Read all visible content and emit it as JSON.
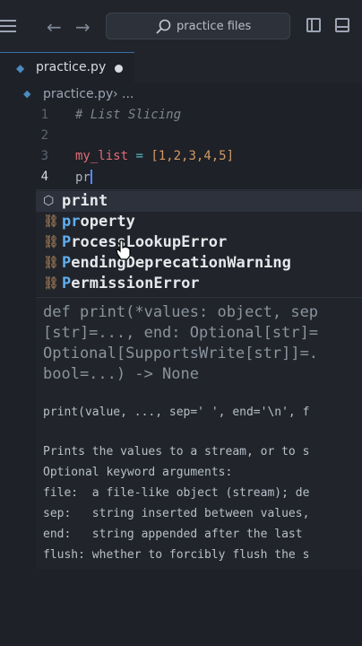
{
  "titlebar": {
    "search_text": "practice files",
    "back_arrow": "←",
    "forward_arrow": "→"
  },
  "tab": {
    "label": "practice.py",
    "modified": true
  },
  "breadcrumb": {
    "file": "practice.py",
    "separator": "› ..."
  },
  "editor": {
    "lines": [
      {
        "number": "1",
        "comment": "# List Slicing"
      },
      {
        "number": "2"
      },
      {
        "number": "3",
        "var": "my_list",
        "op": " = ",
        "open": "[",
        "values": "1,2,3,4,5",
        "close": "]"
      },
      {
        "number": "4",
        "text": "pr"
      }
    ]
  },
  "suggestions": [
    {
      "icon": "method-icon",
      "match": "print",
      "rest": "",
      "selected": true
    },
    {
      "icon": "class-icon",
      "match": "pr",
      "rest": "operty"
    },
    {
      "icon": "class-icon",
      "match": "P",
      "rest": "rocessLookupError"
    },
    {
      "icon": "class-icon",
      "match": "P",
      "rest": "endingDeprecationWarning"
    },
    {
      "icon": "class-icon",
      "match": "P",
      "rest": "ermissionError"
    }
  ],
  "docs": {
    "signature": [
      "def print(*values: object, sep",
      "[str]=..., end: Optional[str]=",
      "Optional[SupportsWrite[str]]=.",
      "bool=...) -> None"
    ],
    "usage": "print(value, ..., sep=' ', end='\\n', f",
    "description": [
      "Prints the values to a stream, or to s",
      "Optional keyword arguments:",
      "file:  a file-like object (stream); de",
      "sep:   string inserted between values,",
      "end:   string appended after the last",
      "flush: whether to forcibly flush the s"
    ]
  },
  "colors": {
    "background": "#1e2127",
    "accent": "#528bff",
    "match_highlight": "#61afef",
    "class_icon": "#d19a66"
  }
}
